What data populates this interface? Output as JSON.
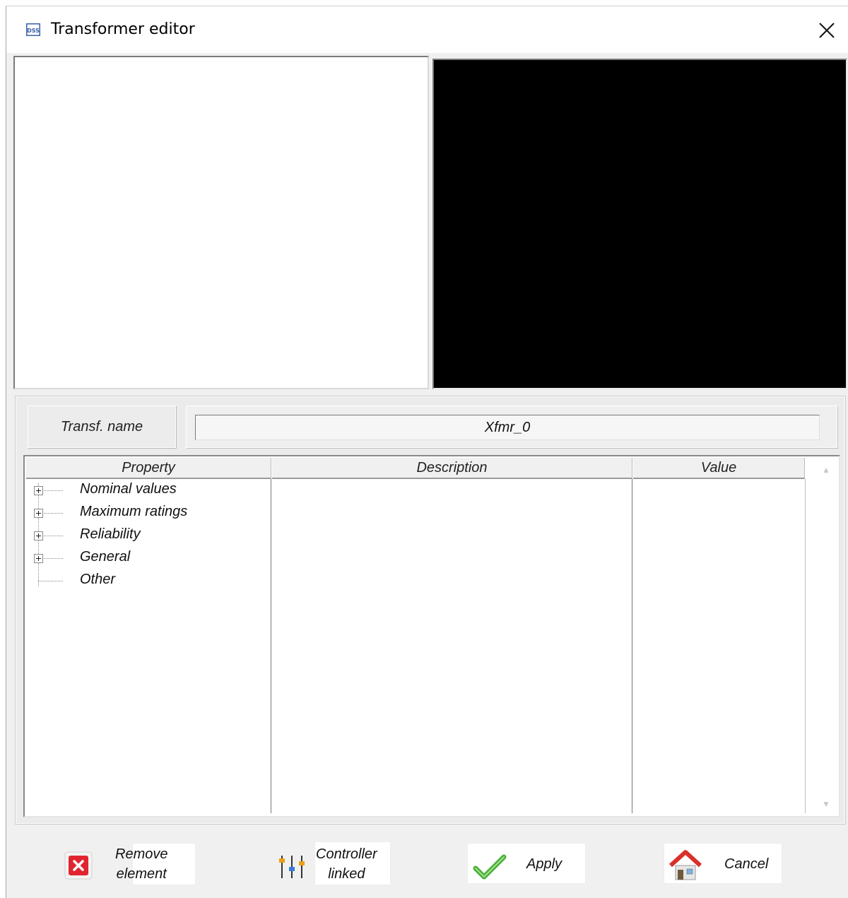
{
  "window": {
    "title": "Transformer editor",
    "app_icon": "dss-app-icon",
    "close_icon": "close-icon"
  },
  "name_row": {
    "label": "Transf. name",
    "value": "Xfmr_0"
  },
  "grid": {
    "columns": [
      "Property",
      "Description",
      "Value"
    ],
    "tree": [
      {
        "label": "Nominal values",
        "expandable": true
      },
      {
        "label": "Maximum ratings",
        "expandable": true
      },
      {
        "label": "Reliability",
        "expandable": true
      },
      {
        "label": "General",
        "expandable": true
      },
      {
        "label": "Other",
        "expandable": false
      }
    ]
  },
  "buttons": {
    "remove": {
      "line1": "Remove",
      "line2": "element",
      "icon": "remove-icon",
      "color": "#e0252f"
    },
    "controller": {
      "line1": "Controller",
      "line2": "linked",
      "icon": "sliders-icon"
    },
    "apply": {
      "label": "Apply",
      "icon": "checkmark-icon",
      "color": "#4caf3a"
    },
    "cancel": {
      "label": "Cancel",
      "icon": "home-icon",
      "color": "#d9302c"
    }
  }
}
